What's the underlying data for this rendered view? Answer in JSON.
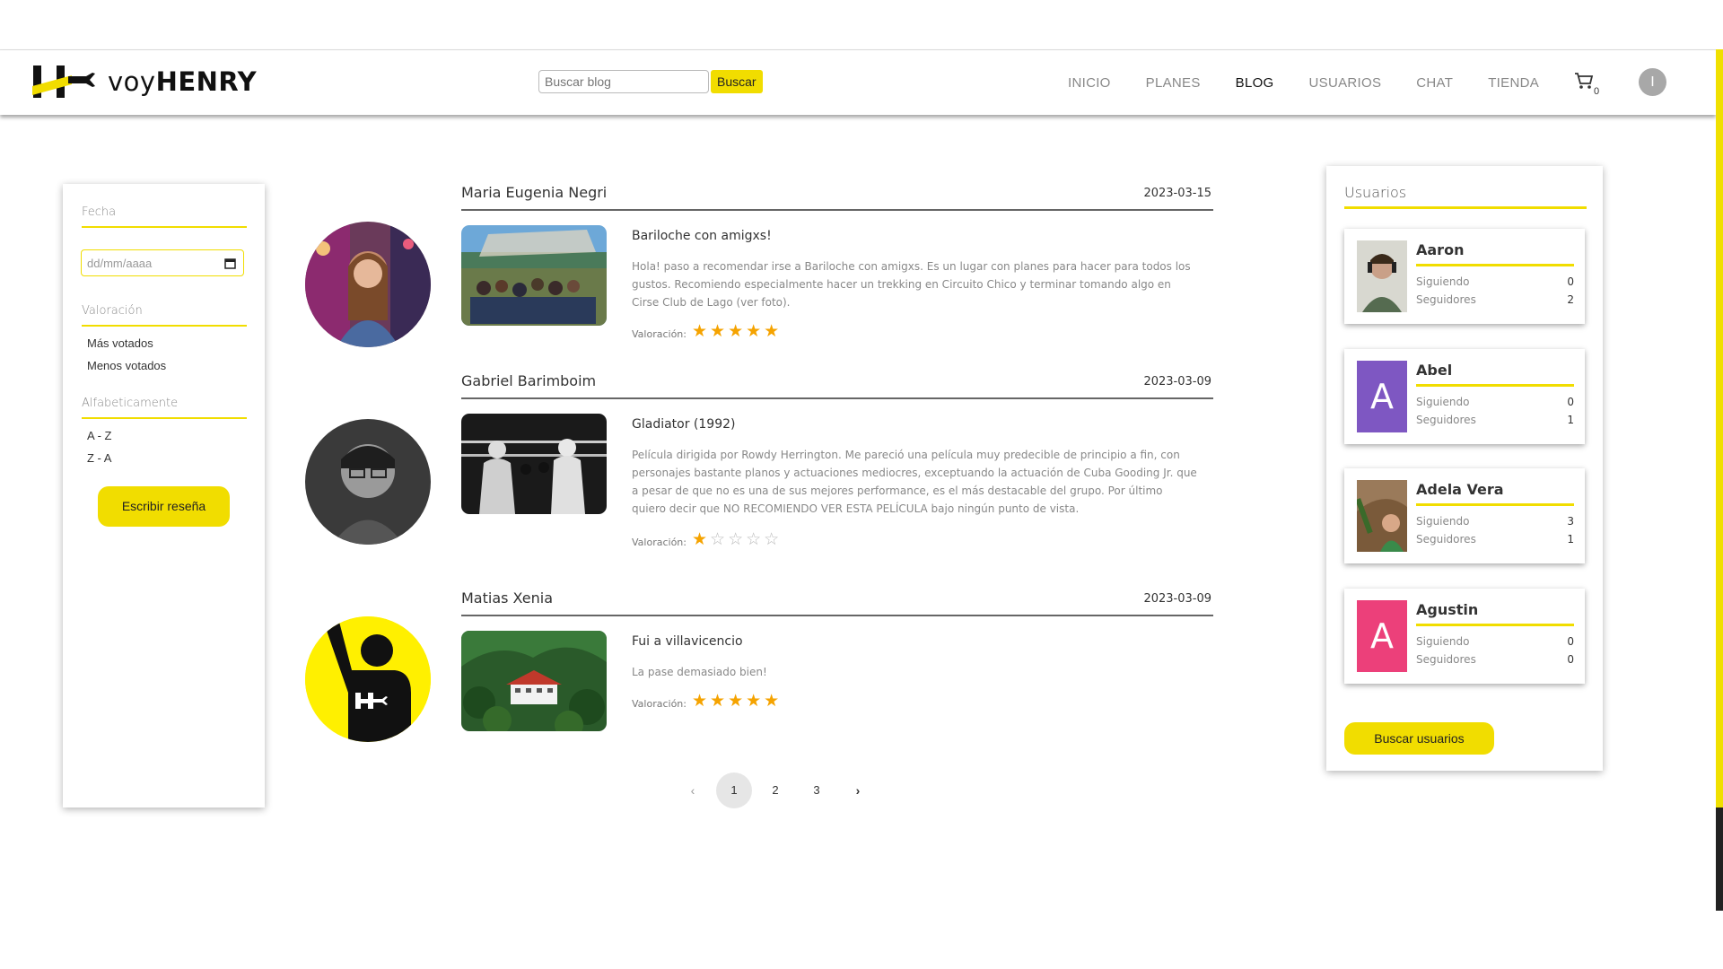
{
  "header": {
    "logo_text_light": "voy",
    "logo_text_bold": "HENRY",
    "search_placeholder": "Buscar blog",
    "search_button": "Buscar",
    "nav": [
      "INICIO",
      "PLANES",
      "BLOG",
      "USUARIOS",
      "CHAT",
      "TIENDA"
    ],
    "active_nav": "BLOG",
    "cart_count": "0",
    "user_initial": "I",
    "icons": [
      "henry-logo-icon",
      "cart-icon"
    ]
  },
  "filters": {
    "fecha_label": "Fecha",
    "date_placeholder": "dd/mm/aaaa",
    "valoracion_label": "Valoración",
    "valoracion_options": [
      "Más votados",
      "Menos votados"
    ],
    "alfabeticamente_label": "Alfabeticamente",
    "alfa_options": [
      "A - Z",
      "Z - A"
    ],
    "write_review_button": "Escribir reseña"
  },
  "posts": [
    {
      "author": "Maria Eugenia Negri",
      "date": "2023-03-15",
      "title": "Bariloche con amigxs!",
      "body": "Hola! paso a recomendar irse a Bariloche con amigxs. Es un lugar con planes para hacer para todos los gustos. Recomiendo especialmente hacer un trekking en Circuito Chico y terminar tomando algo en Cirse Club de Lago (ver foto).",
      "rating_label": "Valoración:",
      "rating": 5
    },
    {
      "author": "Gabriel Barimboim",
      "date": "2023-03-09",
      "title": "Gladiator (1992)",
      "body": "Película dirigida por Rowdy Herrington. Me pareció una película muy predecible de principio a fin, con personajes bastante planos y actuaciones mediocres, exceptuando la actuación de Cuba Gooding Jr. que a pesar de que no es una de sus mejores performance, es el más destacable del grupo. Por último quiero decir que NO RECOMIENDO VER ESTA PELÍCULA bajo ningún punto de vista.",
      "rating_label": "Valoración:",
      "rating": 1
    },
    {
      "author": "Matias Xenia",
      "date": "2023-03-09",
      "title": "Fui a villavicencio",
      "body": "La pase demasiado bien!",
      "rating_label": "Valoración:",
      "rating": 5
    }
  ],
  "pagination": {
    "prev": "‹",
    "pages": [
      "1",
      "2",
      "3"
    ],
    "current": "1",
    "next": "›"
  },
  "users_panel": {
    "title": "Usuarios",
    "following_label": "Siguiendo",
    "followers_label": "Seguidores",
    "users": [
      {
        "name": "Aaron",
        "siguiendo": "0",
        "seguidores": "2",
        "avatar": "photo"
      },
      {
        "name": "Abel",
        "siguiendo": "0",
        "seguidores": "1",
        "avatar": "A",
        "color": "#7e57c2"
      },
      {
        "name": "Adela Vera",
        "siguiendo": "3",
        "seguidores": "1",
        "avatar": "photo"
      },
      {
        "name": "Agustin",
        "siguiendo": "0",
        "seguidores": "0",
        "avatar": "A",
        "color": "#ec407a"
      }
    ],
    "search_users_button": "Buscar usuarios"
  },
  "colors": {
    "accent": "#f1dd00",
    "star": "#f5a300"
  }
}
